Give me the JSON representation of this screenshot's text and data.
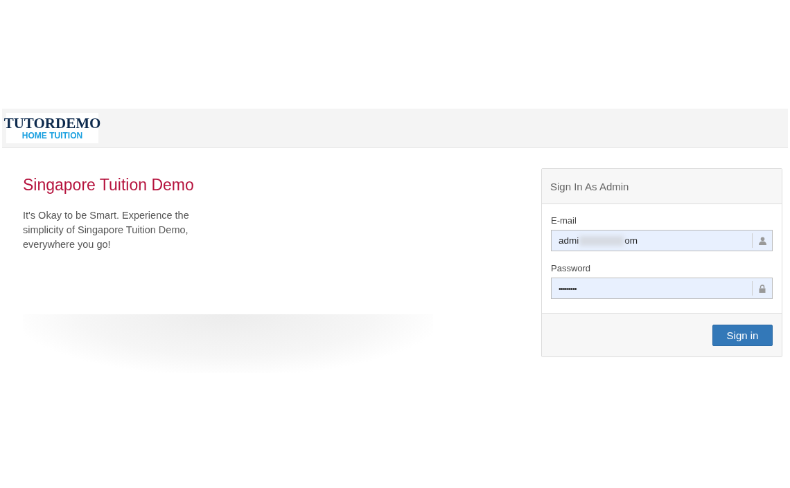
{
  "logo": {
    "title": "TUTORDEMO",
    "subtitle": "HOME TUITION"
  },
  "intro": {
    "heading": "Singapore Tuition Demo",
    "text": "It's Okay to be Smart. Experience the simplicity of Singapore Tuition Demo, everywhere you go!"
  },
  "login": {
    "title": "Sign In As Admin",
    "email": {
      "label": "E-mail",
      "value_start": "admi",
      "value_end": "om"
    },
    "password": {
      "label": "Password",
      "value": "•••••••••"
    },
    "button": "Sign in"
  }
}
